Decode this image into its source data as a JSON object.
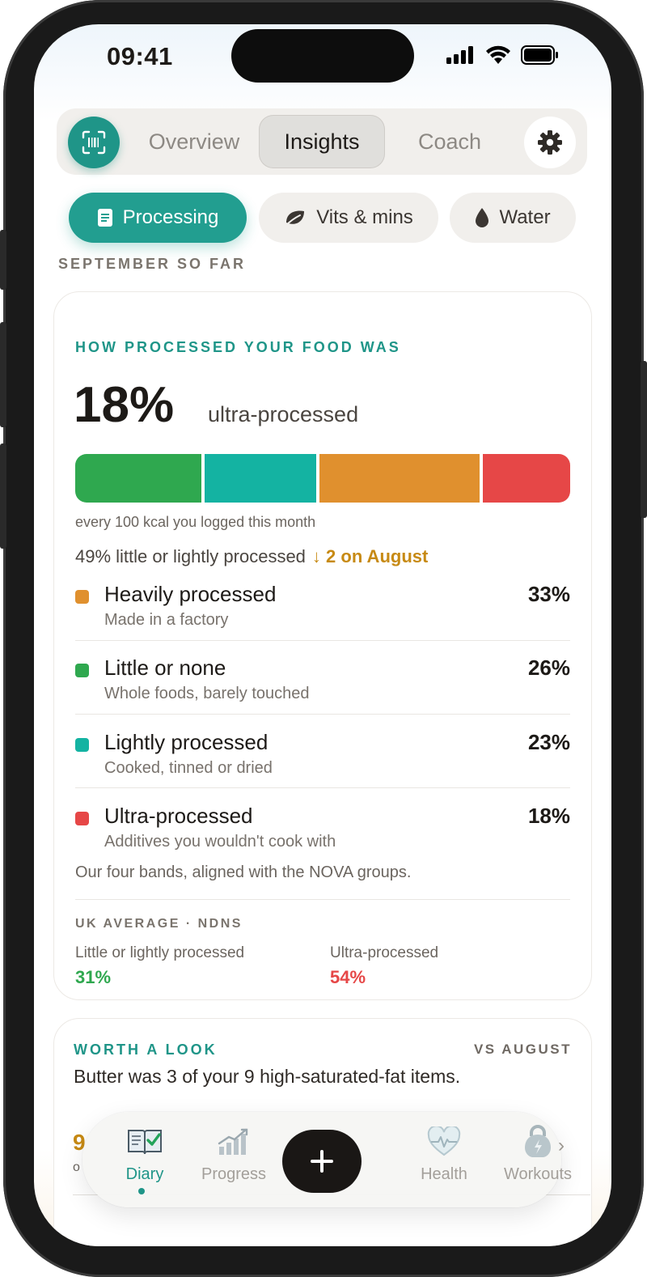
{
  "status": {
    "time": "09:41"
  },
  "topnav": {
    "tabs": [
      "Overview",
      "Insights",
      "Coach"
    ],
    "active": "Insights"
  },
  "chips": [
    {
      "label": "Processing",
      "icon": "document-icon"
    },
    {
      "label": "Vits & mins",
      "icon": "leaf-icon"
    },
    {
      "label": "Water",
      "icon": "water-drop-icon"
    }
  ],
  "section_label": "SEPTEMBER SO FAR",
  "processing_card": {
    "eyebrow": "HOW PROCESSED YOUR FOOD WAS",
    "headline_value": "18%",
    "headline_label": "ultra-processed",
    "bar_caption": "every 100 kcal you logged this month",
    "summary": "49% little or lightly processed",
    "summary_delta": "↓ 2 on August",
    "bands": [
      {
        "title": "Heavily processed",
        "desc": "Made in a factory",
        "pct": "33%",
        "value": 33,
        "color": "#e0902e"
      },
      {
        "title": "Little or none",
        "desc": "Whole foods, barely touched",
        "pct": "26%",
        "value": 26,
        "color": "#2fa84f"
      },
      {
        "title": "Lightly processed",
        "desc": "Cooked, tinned or dried",
        "pct": "23%",
        "value": 23,
        "color": "#14b3a2"
      },
      {
        "title": "Ultra-processed",
        "desc": "Additives you wouldn't cook with",
        "pct": "18%",
        "value": 18,
        "color": "#e64747"
      }
    ],
    "bar_order": [
      {
        "value": 26,
        "color": "#2fa84f"
      },
      {
        "value": 23,
        "color": "#14b3a2"
      },
      {
        "value": 33,
        "color": "#e0902e"
      },
      {
        "value": 18,
        "color": "#e64747"
      }
    ],
    "nova_note": "Our four bands, aligned with the NOVA groups.",
    "uk_label": "UK AVERAGE · NDNS",
    "uk": [
      {
        "label": "Little or lightly processed",
        "value": "31%",
        "color": "#2fa84f"
      },
      {
        "label": "Ultra-processed",
        "value": "54%",
        "color": "#e64747"
      }
    ]
  },
  "worth_card": {
    "eyebrow": "WORTH A LOOK",
    "right_label": "VS AUGUST",
    "text": "Butter was 3 of your 9 high-saturated-fat items.",
    "peek_num": "9",
    "peek_sub": "o"
  },
  "tabbar": {
    "tabs": [
      {
        "label": "Diary",
        "icon": "book-check-icon"
      },
      {
        "label": "Progress",
        "icon": "chart-up-icon"
      },
      {
        "label": "Health",
        "icon": "heart-pulse-icon"
      },
      {
        "label": "Workouts",
        "icon": "kettlebell-icon"
      }
    ],
    "add": "+"
  }
}
